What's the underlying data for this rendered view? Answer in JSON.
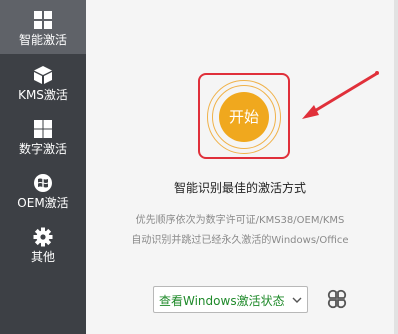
{
  "sidebar": {
    "items": [
      {
        "label": "智能激活",
        "icon": "windows-icon",
        "active": true
      },
      {
        "label": "KMS激活",
        "icon": "cube-icon",
        "active": false
      },
      {
        "label": "数字激活",
        "icon": "windows-grid-icon",
        "active": false
      },
      {
        "label": "OEM激活",
        "icon": "windows-xp-icon",
        "active": false
      },
      {
        "label": "其他",
        "icon": "gear-icon",
        "active": false
      }
    ]
  },
  "main": {
    "start_label": "开始",
    "headline": "智能识别最佳的激活方式",
    "desc_line1": "优先顺序依次为数字许可证/KMS38/OEM/KMS",
    "desc_line2": "自动识别并跳过已经永久激活的Windows/Office",
    "status_select": "查看Windows激活状态",
    "grid_icon": "clover-icon"
  },
  "colors": {
    "sidebar_bg": "#3d4045",
    "sidebar_active": "#5f6268",
    "start_button": "#f0a81e",
    "highlight_red": "#e0303a",
    "select_text": "#1f8a2a"
  }
}
